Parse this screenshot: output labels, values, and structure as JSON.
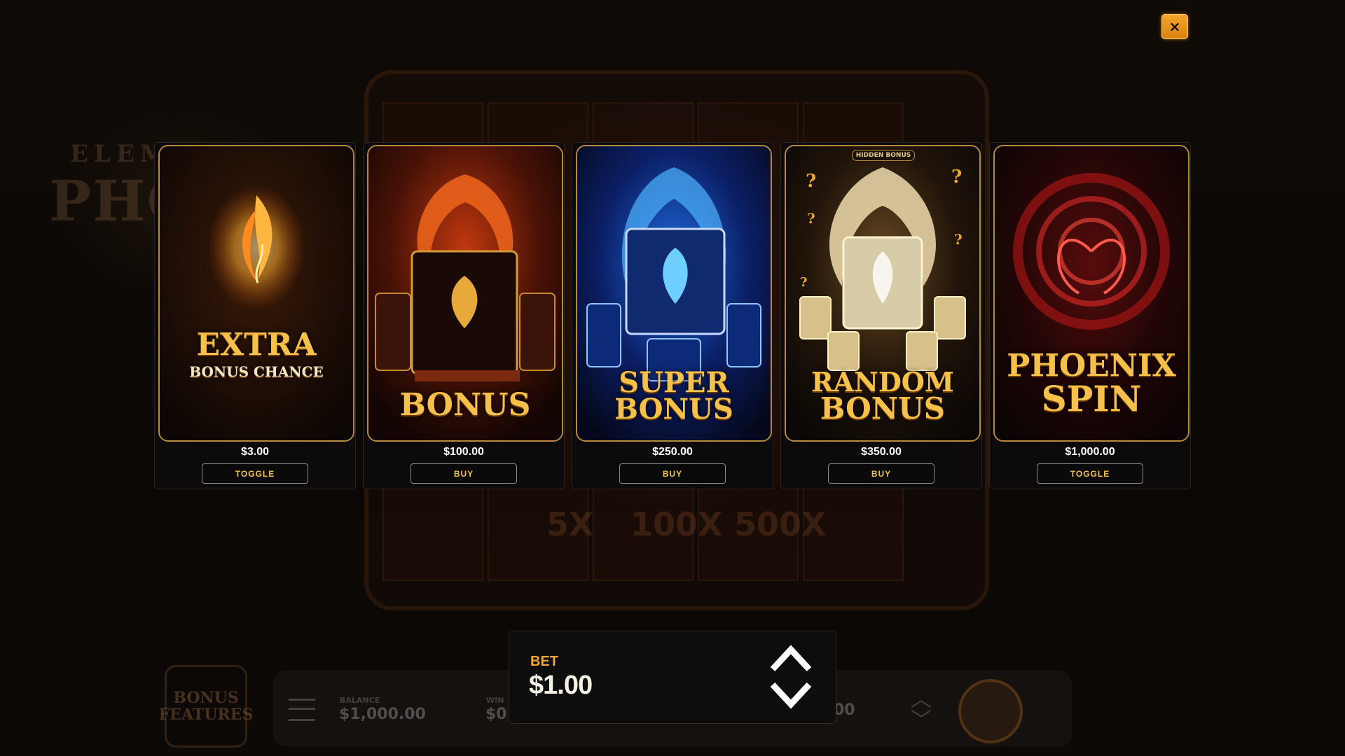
{
  "close_button": {
    "label": "×",
    "icon": "close-icon"
  },
  "cards": [
    {
      "title_line1": "EXTRA",
      "title_line2": "BONUS CHANCE",
      "price": "$3.00",
      "action": "TOGGLE",
      "theme": "#f5a623"
    },
    {
      "title_line1": "BONUS",
      "price": "$100.00",
      "action": "BUY",
      "theme": "#e0561c"
    },
    {
      "title_line1": "SUPER",
      "title_line2": "BONUS",
      "price": "$250.00",
      "action": "BUY",
      "theme": "#2f8cff"
    },
    {
      "title_line1": "RANDOM",
      "title_line2": "BONUS",
      "tag": "HIDDEN BONUS",
      "price": "$350.00",
      "action": "BUY",
      "theme": "#e8c679"
    },
    {
      "title_line1": "PHOENIX",
      "title_line2": "SPIN",
      "price": "$1,000.00",
      "action": "TOGGLE",
      "theme": "#c21818"
    }
  ],
  "bet": {
    "label": "BET",
    "value": "$1.00"
  },
  "background": {
    "logo_line1": "ELEM",
    "logo_line2": "PHO",
    "multipliers": [
      "5X",
      "100X",
      "500X"
    ],
    "bonus_features": "BONUS FEATURES",
    "balance_label": "BALANCE",
    "balance_value": "$1,000.00",
    "win_label": "WIN",
    "win_value": "$0",
    "bet_value_partial": "00"
  },
  "colors": {
    "accent_gold": "#f3c24e",
    "bet_orange": "#f3a62c",
    "close_orange": "#f4a52a"
  }
}
